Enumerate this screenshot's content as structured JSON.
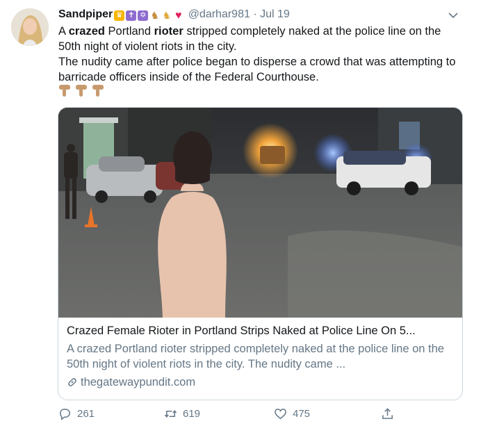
{
  "tweet": {
    "display_name": "Sandpiper",
    "name_emojis": [
      "crown-emoji",
      "latin-cross-emoji",
      "star-of-david-emoji",
      "dog-emoji",
      "dog-emoji",
      "red-heart-emoji"
    ],
    "handle": "@darhar981",
    "separator": "·",
    "date": "Jul 19",
    "text": {
      "p1_a": "A ",
      "p1_crazed": "crazed",
      "p1_b": " Portland ",
      "p1_rioter": "rioter",
      "p1_c": " stripped completely naked at the police line on the 50th night of violent riots in the city.",
      "p2": "The nudity came after police began to disperse a crowd that was attempting to barricade officers inside of the Federal Courthouse."
    },
    "hand_emojis": [
      "thumbs-down-hand-emoji",
      "thumbs-down-hand-emoji",
      "thumbs-down-hand-emoji"
    ],
    "card": {
      "title": "Crazed Female Rioter in Portland Strips Naked at Police Line On 5...",
      "description": "A crazed Portland rioter stripped completely naked at the police line on the 50th night of violent riots in the city. The nudity came ...",
      "domain": "thegatewaypundit.com",
      "media_icon": "street-scene-photo"
    },
    "actions": {
      "reply_count": "261",
      "retweet_count": "619",
      "like_count": "475"
    }
  },
  "colors": {
    "text": "#14171a",
    "muted": "#657786",
    "border": "#ccd6dd"
  }
}
